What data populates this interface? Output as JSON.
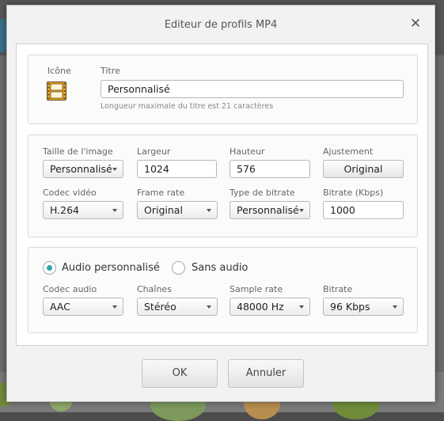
{
  "dialog": {
    "title": "Editeur de profils MP4",
    "close_symbol": "✕"
  },
  "profile": {
    "icon_label": "Icône",
    "icon": "film-icon",
    "title_label": "Titre",
    "title_value": "Personnalisé",
    "title_hint": "Longueur maximale du titre est 21 caractères"
  },
  "video": {
    "image_size_label": "Taille de l'image",
    "image_size_value": "Personnalisé",
    "width_label": "Largeur",
    "width_value": "1024",
    "height_label": "Hauteur",
    "height_value": "576",
    "adjust_label": "Ajustement",
    "adjust_button": "Original",
    "codec_label": "Codec vidéo",
    "codec_value": "H.264",
    "framerate_label": "Frame rate",
    "framerate_value": "Original",
    "bitrate_type_label": "Type de bitrate",
    "bitrate_type_value": "Personnalisé",
    "bitrate_label": "Bitrate (Kbps)",
    "bitrate_value": "1000"
  },
  "audio": {
    "custom_option": "Audio personnalisé",
    "custom_selected": true,
    "none_option": "Sans audio",
    "codec_label": "Codec audio",
    "codec_value": "AAC",
    "channels_label": "Chaînes",
    "channels_value": "Stéréo",
    "samplerate_label": "Sample rate",
    "samplerate_value": "48000 Hz",
    "bitrate_label": "Bitrate",
    "bitrate_value": "96 Kbps"
  },
  "footer": {
    "ok_label": "OK",
    "cancel_label": "Annuler"
  },
  "colors": {
    "accent": "#2aa3b2"
  }
}
